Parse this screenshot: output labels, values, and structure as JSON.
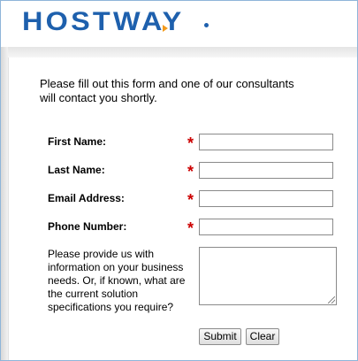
{
  "header": {
    "logo_text": "HOSTWAY",
    "accent_color": "#1e60ad",
    "logo_accent_color": "#f39a1c"
  },
  "form": {
    "intro": "Please fill out this form and one of our consultants will contact you shortly.",
    "required_marker": "*",
    "fields": [
      {
        "label": "First Name:",
        "value": ""
      },
      {
        "label": "Last Name:",
        "value": ""
      },
      {
        "label": "Email Address:",
        "value": ""
      },
      {
        "label": "Phone Number:",
        "value": ""
      }
    ],
    "needs_prompt": "Please provide us with information on your business needs. Or, if known, what are the current solution specifications you require?",
    "needs_value": "",
    "submit_label": "Submit",
    "clear_label": "Clear"
  }
}
